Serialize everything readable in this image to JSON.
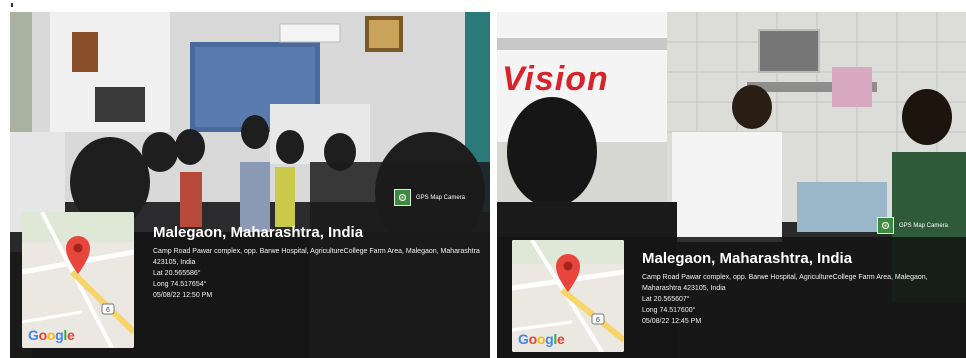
{
  "photos": [
    {
      "gps_tag": "GPS Map Camera",
      "location_title": "Malegaon, Maharashtra, India",
      "address": "Camp Road Pawar complex, opp. Barwe Hospital, AgricultureCollege Farm Area, Malegaon, Maharashtra 423105, India",
      "lat": "Lat 20.565586°",
      "long": "Long 74.517654°",
      "datetime": "05/08/22 12:50 PM",
      "map_logo": [
        "G",
        "o",
        "o",
        "g",
        "l",
        "e"
      ],
      "map_route_badge": "6"
    },
    {
      "gps_tag": "GPS Map Camera",
      "location_title": "Malegaon, Maharashtra, India",
      "address": "Camp Road Pawar complex, opp. Barwe Hospital, AgricultureCollege Farm Area, Malegaon, Maharashtra 423105, India",
      "lat": "Lat 20.565607°",
      "long": "Long 74.517600°",
      "datetime": "05/08/22 12:45 PM",
      "map_logo": [
        "G",
        "o",
        "o",
        "g",
        "l",
        "e"
      ],
      "map_route_badge": "6"
    }
  ],
  "banner_text": "Vision",
  "colors": {
    "map_pin": "#e8453c",
    "gps_badge": "#3c8a3c",
    "banner_red": "#d8232a"
  }
}
